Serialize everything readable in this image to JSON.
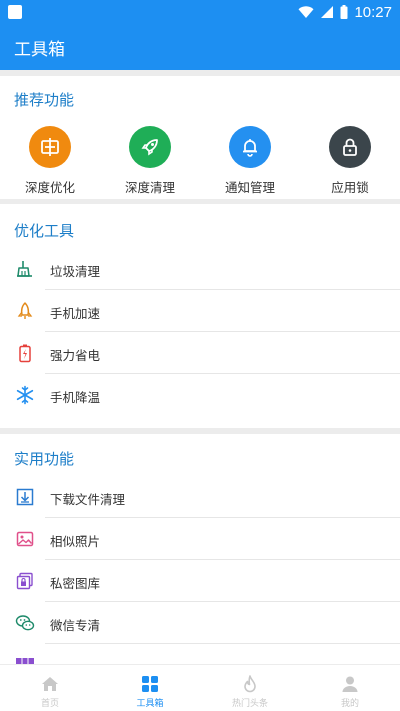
{
  "status_bar": {
    "time": "10:27"
  },
  "app_bar": {
    "title": "工具箱"
  },
  "recommended": {
    "title": "推荐功能",
    "items": [
      {
        "label": "深度优化",
        "color": "#f08a0f",
        "icon": "chip-icon"
      },
      {
        "label": "深度清理",
        "color": "#1fae57",
        "icon": "rocket-icon"
      },
      {
        "label": "通知管理",
        "color": "#2490f0",
        "icon": "bell-icon"
      },
      {
        "label": "应用锁",
        "color": "#3b454b",
        "icon": "lock-icon"
      }
    ]
  },
  "optimize": {
    "title": "优化工具",
    "items": [
      {
        "label": "垃圾清理",
        "icon": "broom-icon",
        "color": "#1e8a6a"
      },
      {
        "label": "手机加速",
        "icon": "rocket-outline-icon",
        "color": "#e38a1a"
      },
      {
        "label": "强力省电",
        "icon": "battery-icon",
        "color": "#e5413c"
      },
      {
        "label": "手机降温",
        "icon": "snowflake-icon",
        "color": "#2490f0"
      }
    ]
  },
  "practical": {
    "title": "实用功能",
    "items": [
      {
        "label": "下载文件清理",
        "icon": "download-icon",
        "color": "#2a7bd0"
      },
      {
        "label": "相似照片",
        "icon": "image-icon",
        "color": "#e0508a"
      },
      {
        "label": "私密图库",
        "icon": "private-gallery-icon",
        "color": "#8a4fcf"
      },
      {
        "label": "微信专清",
        "icon": "wechat-icon",
        "color": "#1e8a6a"
      }
    ]
  },
  "bottom_nav": {
    "items": [
      {
        "label": "首页",
        "icon": "home-icon",
        "active": false
      },
      {
        "label": "工具箱",
        "icon": "grid-icon",
        "active": true
      },
      {
        "label": "热门头条",
        "icon": "flame-icon",
        "active": false
      },
      {
        "label": "我的",
        "icon": "person-icon",
        "active": false
      }
    ]
  }
}
